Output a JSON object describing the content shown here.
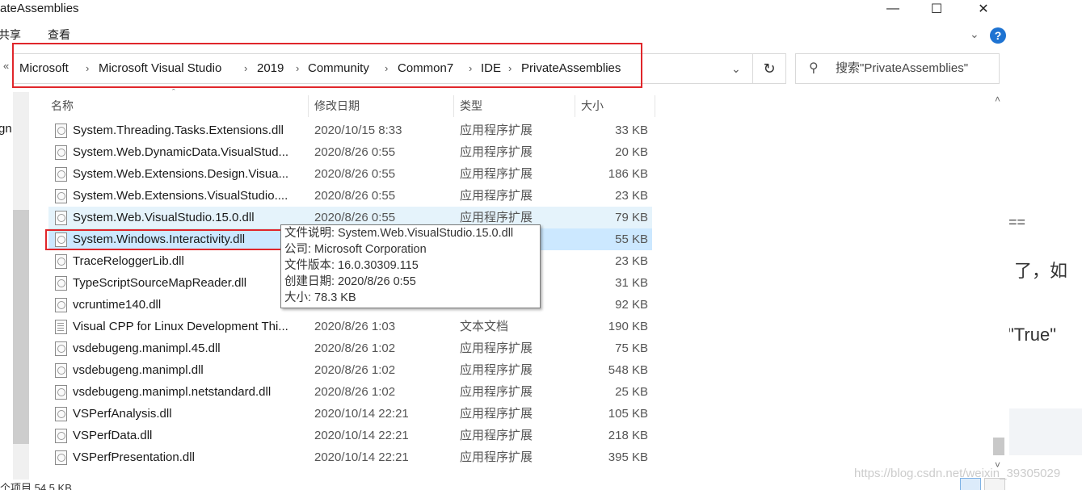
{
  "window": {
    "title": "ateAssemblies",
    "min_icon": "minimize-icon",
    "max_icon": "maximize-icon",
    "close_icon": "close-icon"
  },
  "ribbon": {
    "share": "共享",
    "view": "查看"
  },
  "address": {
    "back_glyph": "«",
    "crumbs": [
      "Microsoft",
      "Microsoft Visual Studio",
      "2019",
      "Community",
      "Common7",
      "IDE",
      "PrivateAssemblies"
    ],
    "search_placeholder": "搜索\"PrivateAssemblies\""
  },
  "columns": {
    "name": "名称",
    "date": "修改日期",
    "type": "类型",
    "size": "大小"
  },
  "files": [
    {
      "name": "System.Threading.Tasks.Extensions.dll",
      "date": "2020/10/15 8:33",
      "type": "应用程序扩展",
      "size": "33 KB"
    },
    {
      "name": "System.Web.DynamicData.VisualStud...",
      "date": "2020/8/26 0:55",
      "type": "应用程序扩展",
      "size": "20 KB"
    },
    {
      "name": "System.Web.Extensions.Design.Visua...",
      "date": "2020/8/26 0:55",
      "type": "应用程序扩展",
      "size": "186 KB"
    },
    {
      "name": "System.Web.Extensions.VisualStudio....",
      "date": "2020/8/26 0:55",
      "type": "应用程序扩展",
      "size": "23 KB"
    },
    {
      "name": "System.Web.VisualStudio.15.0.dll",
      "date": "2020/8/26 0:55",
      "type": "应用程序扩展",
      "size": "79 KB"
    },
    {
      "name": "System.Windows.Interactivity.dll",
      "date": "",
      "type": "",
      "size": "55 KB"
    },
    {
      "name": "TraceReloggerLib.dll",
      "date": "",
      "type": "",
      "size": "23 KB"
    },
    {
      "name": "TypeScriptSourceMapReader.dll",
      "date": "",
      "type": "",
      "size": "31 KB"
    },
    {
      "name": "vcruntime140.dll",
      "date": "",
      "type": "",
      "size": "92 KB"
    },
    {
      "name": "Visual CPP for Linux Development Thi...",
      "date": "2020/8/26 1:03",
      "type": "文本文档",
      "size": "190 KB"
    },
    {
      "name": "vsdebugeng.manimpl.45.dll",
      "date": "2020/8/26 1:02",
      "type": "应用程序扩展",
      "size": "75 KB"
    },
    {
      "name": "vsdebugeng.manimpl.dll",
      "date": "2020/8/26 1:02",
      "type": "应用程序扩展",
      "size": "548 KB"
    },
    {
      "name": "vsdebugeng.manimpl.netstandard.dll",
      "date": "2020/8/26 1:02",
      "type": "应用程序扩展",
      "size": "25 KB"
    },
    {
      "name": "VSPerfAnalysis.dll",
      "date": "2020/10/14 22:21",
      "type": "应用程序扩展",
      "size": "105 KB"
    },
    {
      "name": "VSPerfData.dll",
      "date": "2020/10/14 22:21",
      "type": "应用程序扩展",
      "size": "218 KB"
    },
    {
      "name": "VSPerfPresentation.dll",
      "date": "2020/10/14 22:21",
      "type": "应用程序扩展",
      "size": "395 KB"
    }
  ],
  "tooltip": {
    "desc": "文件说明: System.Web.VisualStudio.15.0.dll",
    "company": "公司: Microsoft Corporation",
    "version": "文件版本: 16.0.30309.115",
    "created": "创建日期: 2020/8/26 0:55",
    "size": "大小: 78.3 KB"
  },
  "status": {
    "text": "个项目  54.5 KB"
  },
  "background_page": {
    "left_fragment": "gn",
    "eq": "==",
    "frag1": "了，如",
    "frag2": "\"True\"",
    "watermark": "https://blog.csdn.net/weixin_39305029"
  },
  "colors": {
    "annotation_red": "#e0262b",
    "selection": "#cce8ff",
    "hover": "#e5f3fb"
  }
}
